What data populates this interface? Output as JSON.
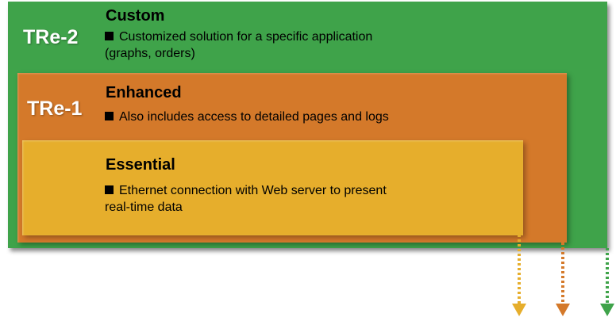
{
  "tiers": {
    "tre2": {
      "label": "TRe-2",
      "title": "Custom",
      "description_line1": "Customized solution for a specific application",
      "description_line2": "(graphs, orders)",
      "color": "#3fa34a"
    },
    "tre1": {
      "label": "TRe-1",
      "title": "Enhanced",
      "description_line1": "Also includes access to detailed pages and logs",
      "color": "#d4792a"
    },
    "tre0": {
      "title": "Essential",
      "description_line1": "Ethernet connection with Web server to present",
      "description_line2": "real-time data",
      "color": "#e6ae2c"
    }
  },
  "arrows": [
    {
      "name": "essential-arrow",
      "color": "#e6ae2c"
    },
    {
      "name": "enhanced-arrow",
      "color": "#d4792a"
    },
    {
      "name": "custom-arrow",
      "color": "#3fa34a"
    }
  ]
}
